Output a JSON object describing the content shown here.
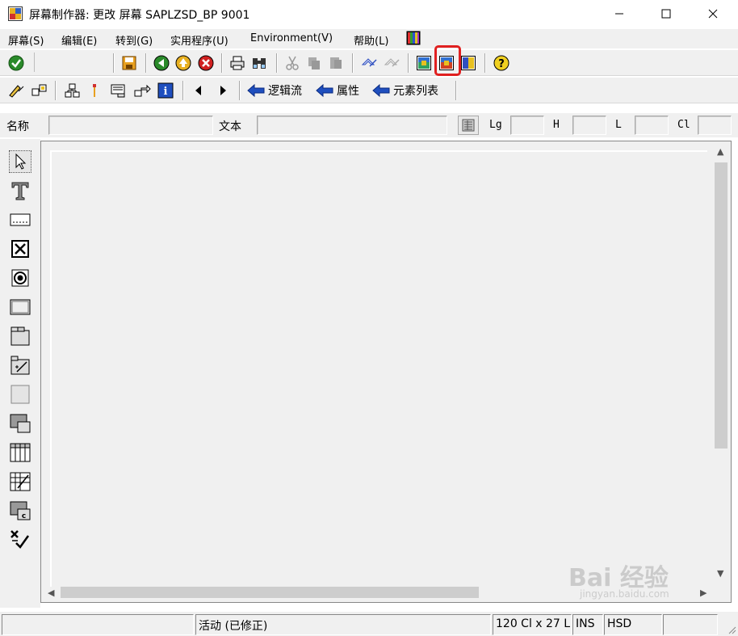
{
  "window": {
    "title": "屏幕制作器:  更改 屏幕 SAPLZSD_BP 9001",
    "buttons": {
      "minimize": "minimize-icon",
      "maximize": "maximize-icon",
      "close": "close-icon"
    }
  },
  "menubar": {
    "items": [
      {
        "label": "屏幕(S)"
      },
      {
        "label": "编辑(E)"
      },
      {
        "label": "转到(G)"
      },
      {
        "label": "实用程序(U)"
      },
      {
        "label": "Environment(V)"
      },
      {
        "label": "帮助(L)"
      }
    ],
    "extra_icon": "layout-colors-icon"
  },
  "toolbar1": {
    "icons": [
      "check-icon",
      "save-icon",
      "back-icon",
      "exit-icon",
      "cancel-icon",
      "print-icon",
      "find-icon",
      "cut-icon",
      "copy-icon",
      "paste-icon",
      "undo-icon",
      "redo-icon",
      "layout-1-icon",
      "layout-2-icon",
      "layout-3-icon",
      "help-icon"
    ],
    "highlight_color": "#e02020"
  },
  "toolbar2": {
    "icons": [
      "edit-pencil-icon",
      "hierarchy-icon",
      "structure-icon",
      "pin-icon",
      "dict-icon",
      "flow-icon",
      "info-icon",
      "prev-icon",
      "next-icon"
    ],
    "nav_buttons": [
      {
        "label": "逻辑流"
      },
      {
        "label": "属性"
      },
      {
        "label": "元素列表"
      }
    ]
  },
  "fieldbar": {
    "name_label": "名称",
    "name_value": "",
    "text_label": "文本",
    "text_value": "",
    "lg_label": "Lg",
    "h_label": "H",
    "l_label": "L",
    "cl_label": "Cl"
  },
  "palette": {
    "tools": [
      "pointer-icon",
      "text-field-icon",
      "input-field-icon",
      "checkbox-icon",
      "radio-button-icon",
      "pushbutton-icon",
      "tabstrip-icon",
      "tabstrip-wizard-icon",
      "box-icon",
      "subscreen-icon",
      "table-control-icon",
      "table-wizard-icon",
      "custom-control-icon",
      "status-icon"
    ]
  },
  "statusbar": {
    "status": "活动 (已修正)",
    "size": "120 Cl x 27 L",
    "mode": "INS",
    "system": "HSD"
  },
  "watermark": {
    "text": "Bai 经验",
    "sub": "jingyan.baidu.com"
  },
  "colors": {
    "background": "#f0f0f0",
    "accent_blue": "#1f4fbf",
    "green": "#2a8a2a",
    "highlight": "#e02020"
  }
}
